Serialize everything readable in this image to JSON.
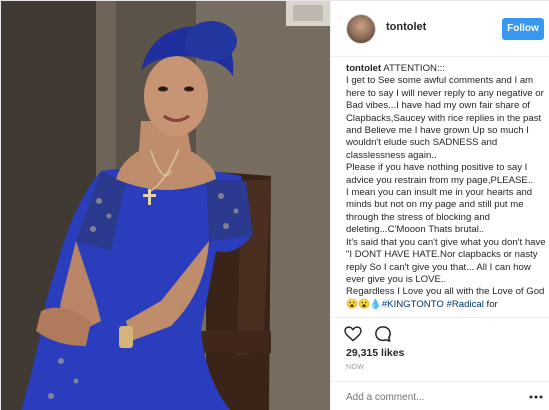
{
  "post": {
    "username": "tontolet",
    "follow_label": "Follow",
    "caption_username": "tontolet",
    "caption_lines": [
      " ATTENTION:::",
      "I get to See some awful comments and I am here to say I will never reply to any negative or Bad vibes...I have had my own fair share of Clapbacks,Saucey with rice replies in the past and Believe me I have grown Up so much I wouldn't elude such SADNESS and classlessness again..",
      "Please if you have nothing positive to say I advice you restrain from my page,PLEASE..",
      "I mean you can insult me in your hearts and minds but not on my page and still put me through the stress of blocking and deleting...C'Mooon Thats brutal..",
      "It's said that you can't give what you don't have \"I DONT HAVE HATE.Nor clapbacks or nasty reply So I can't give you that... All I can how ever give you is LOVE..",
      "Regardless I Love you all with the Love of God 😮😮💧"
    ],
    "hashtags": [
      "#KINGTONTO",
      "#Radical"
    ],
    "caption_tail": " for",
    "likes": "29,315 likes",
    "timestamp": "NOW",
    "comment_placeholder": "Add a comment..."
  },
  "icons": {
    "like": "heart-icon",
    "comment": "comment-icon",
    "more": "more-options-icon"
  },
  "colors": {
    "follow_button": "#3897f0",
    "hashtag": "#003569",
    "dress": "#2a3dbd",
    "headwrap": "#1f2f9e"
  }
}
